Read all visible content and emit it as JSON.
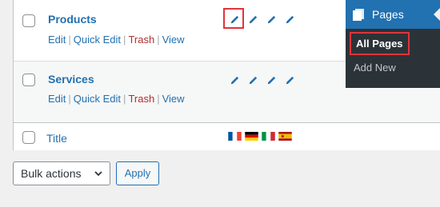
{
  "rows": [
    {
      "title": "Products",
      "actions": {
        "edit": "Edit",
        "quick_edit": "Quick Edit",
        "trash": "Trash",
        "view": "View"
      }
    },
    {
      "title": "Services",
      "actions": {
        "edit": "Edit",
        "quick_edit": "Quick Edit",
        "trash": "Trash",
        "view": "View"
      }
    }
  ],
  "footer": {
    "title": "Title"
  },
  "separator": "|",
  "icons": {
    "pencil": "pencil-icon",
    "flags": [
      "france-flag-icon",
      "germany-flag-icon",
      "italy-flag-icon",
      "spain-flag-icon"
    ],
    "menu": "pages-icon"
  },
  "menu": {
    "header": "Pages",
    "items": [
      "All Pages",
      "Add New"
    ]
  },
  "bulk_actions": {
    "selected": "Bulk actions",
    "apply_label": "Apply"
  },
  "colors": {
    "link": "#2271b1",
    "trash": "#b32d2e",
    "menu_bg": "#2c3338",
    "menu_active": "#2271b1",
    "highlight": "#e0343a"
  }
}
